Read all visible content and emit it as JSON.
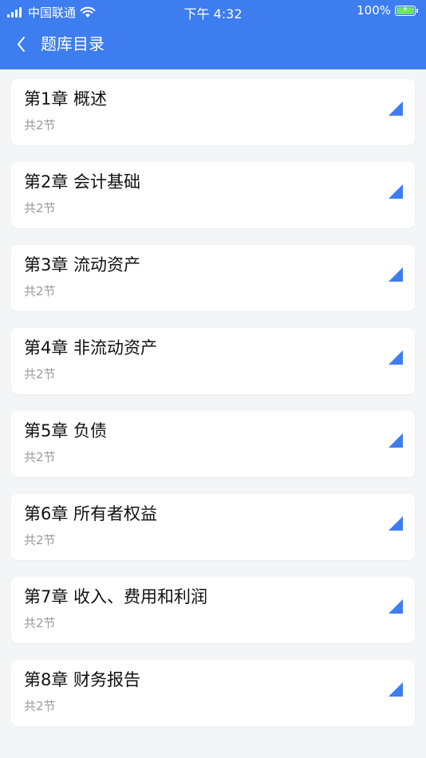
{
  "status": {
    "carrier": "中国联通",
    "time": "下午 4:32",
    "battery": "100%"
  },
  "nav": {
    "title": "题库目录"
  },
  "chapters": [
    {
      "title": "第1章  概述",
      "sub": "共2节"
    },
    {
      "title": "第2章  会计基础",
      "sub": "共2节"
    },
    {
      "title": "第3章  流动资产",
      "sub": "共2节"
    },
    {
      "title": "第4章  非流动资产",
      "sub": "共2节"
    },
    {
      "title": "第5章  负债",
      "sub": "共2节"
    },
    {
      "title": "第6章  所有者权益",
      "sub": "共2节"
    },
    {
      "title": "第7章  收入、费用和利润",
      "sub": "共2节"
    },
    {
      "title": "第8章  财务报告",
      "sub": "共2节"
    }
  ],
  "colors": {
    "header": "#3d7df0",
    "accent": "#3d7df0",
    "background": "#f4f5f7"
  },
  "icons": {
    "back": "chevron-left-icon",
    "expand": "corner-triangle-icon"
  }
}
